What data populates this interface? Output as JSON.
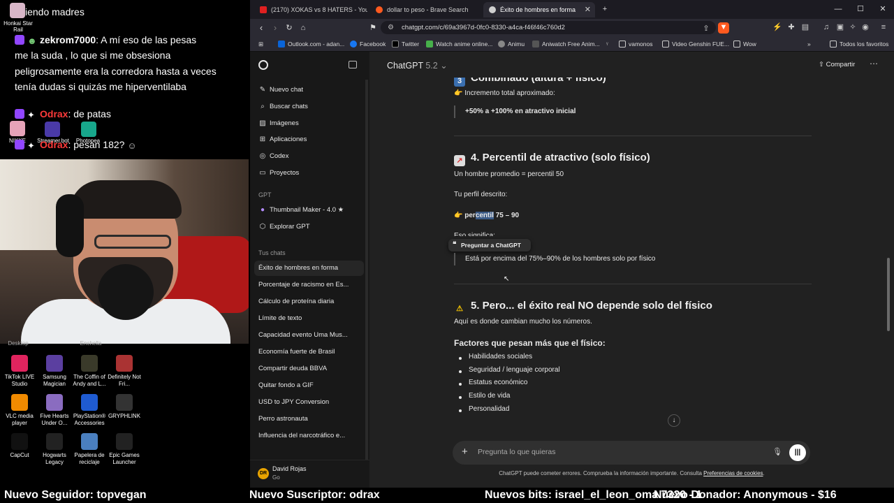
{
  "stream_chat": {
    "top_partial": "iendo madres",
    "honkai_label": "Honkai Star Rail",
    "messages": [
      {
        "user": "zekrom7000",
        "text": ": A mí eso de las pesas",
        "cont": [
          "me la suda , lo que si me obsesiona",
          "peligrosamente era la corredora hasta a veces",
          "tenía dudas si quizás me hiperventilaba"
        ]
      },
      {
        "user": "Odrax",
        "text": ": de patas"
      },
      {
        "user": "Odrax",
        "text": ": pesan 182?"
      }
    ],
    "overlay_labels": [
      "NIKKE",
      "Streamer.bot",
      "Photopea"
    ]
  },
  "desktop_icons": [
    {
      "label": "TikTok LIVE Studio",
      "color": "#e0245e"
    },
    {
      "label": "Samsung Magician",
      "color": "#5b3fa0"
    },
    {
      "label": "The Coffin of Andy and L...",
      "color": "#3a3a2a"
    },
    {
      "label": "Definitely Not Fri...",
      "color": "#a33"
    },
    {
      "label": "VLC media player",
      "color": "#f08a00"
    },
    {
      "label": "Five Hearts Under O...",
      "color": "#8a6cc0"
    },
    {
      "label": "PlayStation® Accessories",
      "color": "#1f5bd1"
    },
    {
      "label": "GRYPHLINK",
      "color": "#333"
    },
    {
      "label": "CapCut",
      "color": "#111"
    },
    {
      "label": "Hogwarts Legacy",
      "color": "#222"
    },
    {
      "label": "Papelera de reciclaje",
      "color": "#4a7fbf"
    },
    {
      "label": "Epic Games Launcher",
      "color": "#222"
    }
  ],
  "desktop_partial_labels": [
    "Desktop",
    "Enchella"
  ],
  "browser": {
    "tabs": [
      {
        "title": "(2170) XOKAS vs 8 HATERS - YouTub",
        "color": "#e02020"
      },
      {
        "title": "dollar to peso - Brave Search",
        "color": "#ff5a1f"
      },
      {
        "title": "Éxito de hombres en forma",
        "color": "#cfcfcf"
      }
    ],
    "url": "chatgpt.com/c/69a3967d-0fc0-8330-a4ca-f46f46c760d2",
    "bookmarks": [
      "Outlook.com - adan...",
      "Facebook",
      "Twitter",
      "Watch anime online...",
      "Animu",
      "Aniwatch Free Anim...",
      "vamonos",
      "Video Genshin FUE...",
      "Wow"
    ],
    "bookmarks_right": "Todos los favoritos"
  },
  "sidebar": {
    "nav": [
      {
        "label": "Nuevo chat",
        "icon": "edit-icon"
      },
      {
        "label": "Buscar chats",
        "icon": "search-icon"
      },
      {
        "label": "Imágenes",
        "icon": "image-icon"
      },
      {
        "label": "Aplicaciones",
        "icon": "apps-icon"
      },
      {
        "label": "Codex",
        "icon": "codex-icon"
      },
      {
        "label": "Proyectos",
        "icon": "folder-icon"
      }
    ],
    "gpt_section": "GPT",
    "gpts": [
      "Thumbnail Maker - 4.0 ★",
      "Explorar GPT"
    ],
    "chats_section": "Tus chats",
    "chats": [
      "Éxito de hombres en forma",
      "Porcentaje de racismo en Es...",
      "Cálculo de proteína diaria",
      "Límite de texto",
      "Capacidad evento Uma Mus...",
      "Economía fuerte de Brasil",
      "Compartir deuda BBVA",
      "Quitar fondo a GIF",
      "USD to JPY Conversion",
      "Perro astronauta",
      "Influencia del narcotráfico e..."
    ],
    "profile": {
      "name": "David Rojas",
      "plan": "Go",
      "initials": "DR"
    }
  },
  "main": {
    "model": "ChatGPT",
    "version": "5.2",
    "share": "Compartir",
    "prev_heading": "Combinado (altura + físico)",
    "incremento": "Incremento total aproximado:",
    "incremento_val": "+50% a +100% en atractivo inicial",
    "h4": "4. Percentil de atractivo (solo físico)",
    "promedio": "Un hombre promedio = percentil 50",
    "perfil": "Tu perfil descrito:",
    "percentil_word": "percentil",
    "percentil_pre": "per",
    "percentil_hl": "centil",
    "percentil_val": " 75 – 90",
    "eso": "Eso significa:",
    "tooltip": "Preguntar a ChatGPT",
    "esta": "Está por encima del 75%–90% de los hombres solo por físico",
    "h5": "5. Pero... el éxito real NO depende solo del físico",
    "aqui": "Aquí es donde cambian mucho los números.",
    "factores": "Factores que pesan más que el físico:",
    "bullets": [
      "Habilidades sociales",
      "Seguridad / lenguaje corporal",
      "Estatus económico",
      "Estilo de vida",
      "Personalidad"
    ],
    "composer_placeholder": "Pregunta lo que quieras",
    "disclaimer": "ChatGPT puede cometer errores. Comprueba la información importante. Consulta",
    "disclaimer_link": "Preferencias de cookies",
    "disclaimer_end": "."
  },
  "ticker": {
    "seguidor": "Nuevo Seguidor: topvegan",
    "suscriptor": "Nuevo Suscriptor: odrax",
    "bits": "Nuevos bits: israel_el_leon_oma 7320 - 1",
    "donador": "Nuevo Donador: Anonymous - $16"
  }
}
